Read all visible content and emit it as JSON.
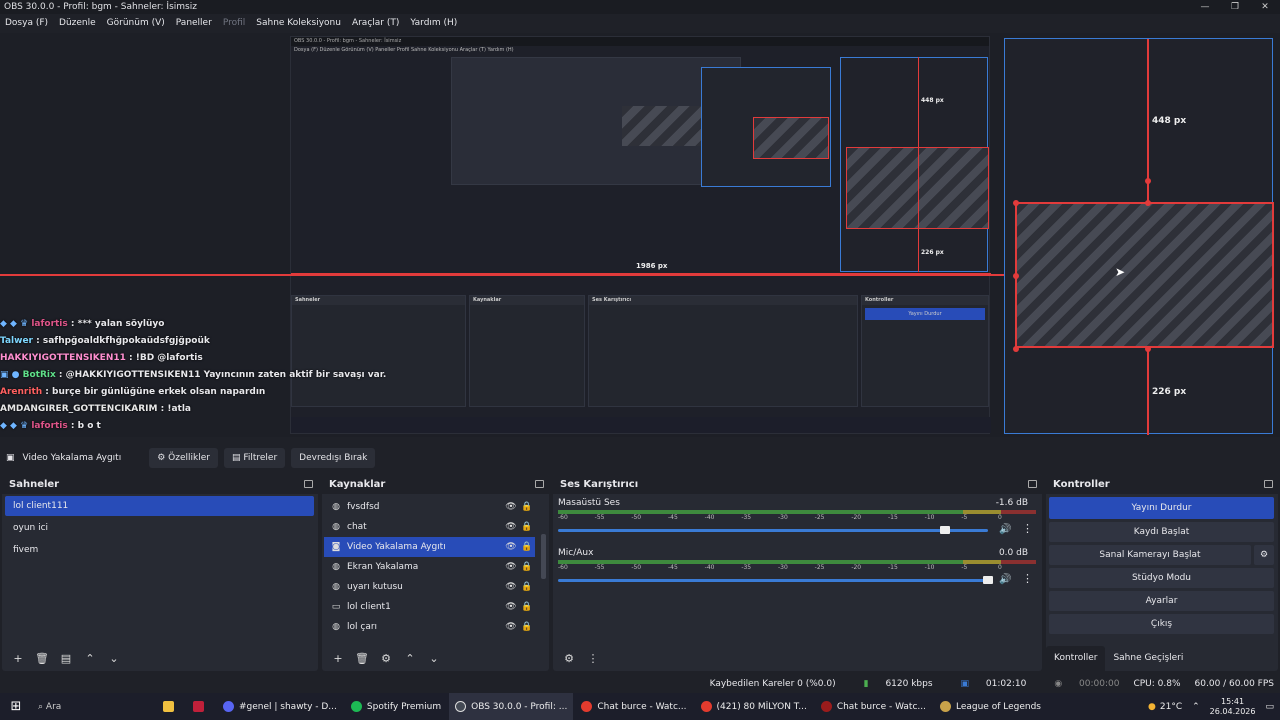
{
  "window": {
    "title": "OBS 30.0.0 - Profil: bgm - Sahneler: İsimsiz",
    "controls": [
      "—",
      "❐",
      "✕"
    ]
  },
  "menu": [
    "Dosya (F)",
    "Düzenle",
    "Görünüm (V)",
    "Paneller",
    "Profil",
    "Sahne Koleksiyonu",
    "Araçlar (T)",
    "Yardım (H)"
  ],
  "preview": {
    "inner_title": "OBS 30.0.0 - Profil: bgm - Sahneler: İsimsiz",
    "inner_menu": "Dosya (F)  Düzenle  Görünüm (V)  Paneller  Profil  Sahne Koleksiyonu  Araçlar (T)  Yardım (H)",
    "size_top": "448 px",
    "size_bottom": "226 px",
    "size_left": "1986 px",
    "inner_size_top": "448 px",
    "inner_size_bottom": "226 px",
    "inner_size_left": "1986 px"
  },
  "chat": [
    {
      "user": "lafortis",
      "text": " : *** yalan söylüyo ",
      "color": "#e0558a"
    },
    {
      "user": "Talwer",
      "text": " : safhpğoaldkfhğpokaüdsfgjğpoük",
      "color": "#7fd7ff"
    },
    {
      "user": "HAKKIYIGOTTENSIKEN11",
      "text": " : !BD @lafortis",
      "color": "#ff8fd0"
    },
    {
      "user": "BotRix",
      "text": " : @HAKKIYIGOTTENSIKEN11 Yayıncının zaten aktif bir savaşı var.",
      "color": "#5fe08a"
    },
    {
      "user": "Arenrith",
      "text": " : burçe bir günlüğüne erkek olsan napardın",
      "color": "#ff6060"
    },
    {
      "user": "AMDANGIRER_GOTTENCIKARIM",
      "text": " : !atla",
      "color": "#e8e8e8"
    },
    {
      "user": "lafortis",
      "text": " : b o t",
      "color": "#e0558a"
    }
  ],
  "source_bar": {
    "name": "Video Yakalama Aygıtı",
    "properties": "Özellikler",
    "filters": "Filtreler",
    "disable": "Devredışı Bırak"
  },
  "scenes": {
    "title": "Sahneler",
    "items": [
      "lol client111",
      "oyun ici",
      "fivem"
    ],
    "selected": 0
  },
  "sources": {
    "title": "Kaynaklar",
    "items": [
      {
        "name": "fvsdfsd",
        "icon": "globe-icon"
      },
      {
        "name": "chat",
        "icon": "globe-icon"
      },
      {
        "name": "Video Yakalama Aygıtı",
        "icon": "camera-icon"
      },
      {
        "name": "Ekran Yakalama",
        "icon": "monitor-icon"
      },
      {
        "name": "uyarı kutusu",
        "icon": "globe-icon"
      },
      {
        "name": "lol client1",
        "icon": "window-icon"
      },
      {
        "name": "lol çarı",
        "icon": "globe-icon"
      }
    ],
    "selected": 2
  },
  "mixer": {
    "title": "Ses Karıştırıcı",
    "channels": [
      {
        "name": "Masaüstü Ses",
        "db": "-1.6 dB",
        "volume": 0.9
      },
      {
        "name": "Mic/Aux",
        "db": "0.0 dB",
        "volume": 1.0
      }
    ],
    "ticks": [
      "-60",
      "-55",
      "-50",
      "-45",
      "-40",
      "-35",
      "-30",
      "-25",
      "-20",
      "-15",
      "-10",
      "-5",
      "0"
    ]
  },
  "controls": {
    "title": "Kontroller",
    "stop_stream": "Yayını Durdur",
    "start_record": "Kaydı Başlat",
    "virtual_cam": "Sanal Kamerayı Başlat",
    "studio_mode": "Stüdyo Modu",
    "settings": "Ayarlar",
    "exit": "Çıkış",
    "tab_controls": "Kontroller",
    "tab_transitions": "Sahne Geçişleri"
  },
  "status": {
    "dropped": "Kaybedilen Kareler 0 (%0.0)",
    "bitrate": "6120 kbps",
    "stream_time": "01:02:10",
    "rec_time": "00:00:00",
    "cpu": "CPU: 0.8%",
    "fps": "60.00 / 60.00 FPS"
  },
  "taskbar": {
    "search": "Ara",
    "apps": [
      {
        "label": "#genel | shawty - D...",
        "color": "#5865f2"
      },
      {
        "label": "Spotify Premium",
        "color": "#1db954"
      },
      {
        "label": "OBS 30.0.0 - Profil: ...",
        "color": "#444a55"
      },
      {
        "label": "Chat burce - Watc...",
        "color": "#e33b2e"
      },
      {
        "label": "(421) 80 MİLYON T...",
        "color": "#e33b2e"
      },
      {
        "label": "Chat burce - Watc...",
        "color": "#9b1c1c"
      },
      {
        "label": "League of Legends",
        "color": "#c8a24a"
      }
    ],
    "weather": "21°C",
    "time": "15:41",
    "date": "26.04.2026"
  },
  "colors": {
    "accent": "#284cb8",
    "outline": "#3a7bd5",
    "guide": "#e23b3b"
  }
}
